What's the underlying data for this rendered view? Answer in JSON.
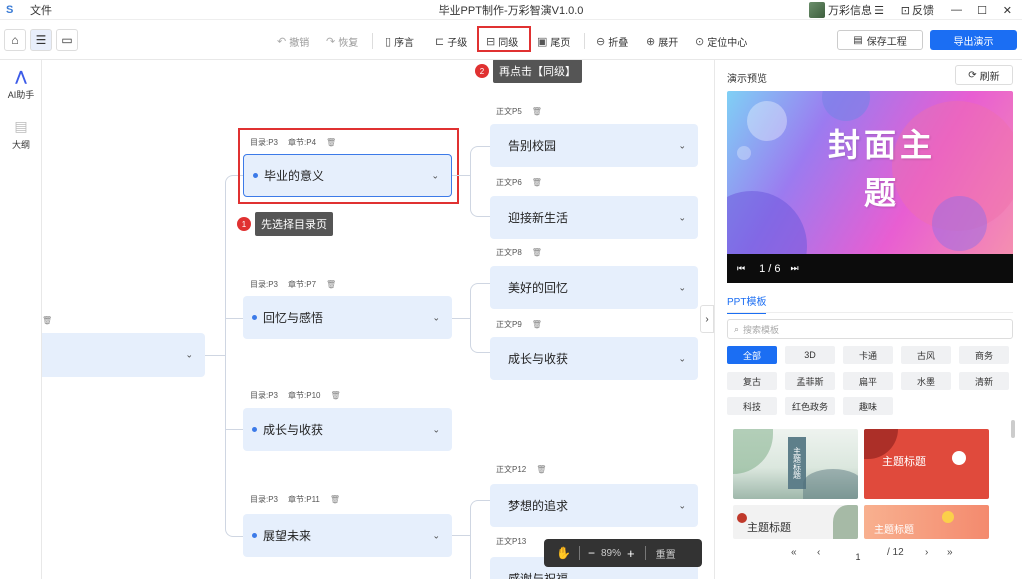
{
  "titlebar": {
    "logo": "S",
    "file_menu": "文件",
    "app_title": "毕业PPT制作-万彩智演V1.0.0",
    "user_name": "万彩信息",
    "feedback": "反馈",
    "menu_icon": "☰",
    "minimize_icon": "—",
    "maximize_icon": "☐",
    "close_icon": "✕"
  },
  "toolbar": {
    "home_icon": "⌂",
    "outline_icon": "☰",
    "screen_icon": "▭",
    "undo": "撤销",
    "redo": "恢复",
    "preface": "序言",
    "child": "子级",
    "sibling": "同级",
    "end_page": "尾页",
    "collapse": "折叠",
    "expand": "展开",
    "locate_center": "定位中心",
    "save_project": "保存工程",
    "export_show": "导出演示"
  },
  "sidebar": {
    "ai_assistant": "AI助手",
    "outline": "大纲"
  },
  "mindmap": {
    "chapters": [
      {
        "catalog": "目录:P3",
        "chapter": "章节:P4",
        "title": "毕业的意义"
      },
      {
        "catalog": "目录:P3",
        "chapter": "章节:P7",
        "title": "回忆与感悟"
      },
      {
        "catalog": "目录:P3",
        "chapter": "章节:P10",
        "title": "成长与收获"
      },
      {
        "catalog": "目录:P3",
        "chapter": "章节:P11",
        "title": "展望未来"
      }
    ],
    "leaves": [
      {
        "tag": "正文P5",
        "title": "告别校园"
      },
      {
        "tag": "正文P6",
        "title": "迎接新生活"
      },
      {
        "tag": "正文P8",
        "title": "美好的回忆"
      },
      {
        "tag": "正文P9",
        "title": "成长与收获"
      },
      {
        "tag": "正文P12",
        "title": "梦想的追求"
      },
      {
        "tag": "正文P13",
        "title": "感谢与祝福"
      }
    ],
    "callout1_num": "1",
    "callout1_text": "先选择目录页",
    "callout2_num": "2",
    "callout2_text": "再点击【同级】"
  },
  "zoom": {
    "zoom_level": "89%",
    "reset": "重置"
  },
  "panel": {
    "preview_title": "演示预览",
    "refresh": "刷新",
    "slide_title": "封面主题",
    "page_indicator": "1 / 6",
    "template_tab": "PPT模板",
    "search_placeholder": "搜索模板",
    "categories": [
      "全部",
      "3D",
      "卡通",
      "古风",
      "商务",
      "复古",
      "孟菲斯",
      "扁平",
      "水墨",
      "清新",
      "科技",
      "红色政务",
      "趣味"
    ],
    "thumb_titles": [
      "主题标题",
      "主题标题",
      "主题标题",
      "主题标题"
    ],
    "current_page": "1",
    "total_pages": "/ 12"
  },
  "colors": {
    "accent": "#1b6ef3",
    "highlight": "#e03131",
    "node_bg": "#e6effc"
  }
}
